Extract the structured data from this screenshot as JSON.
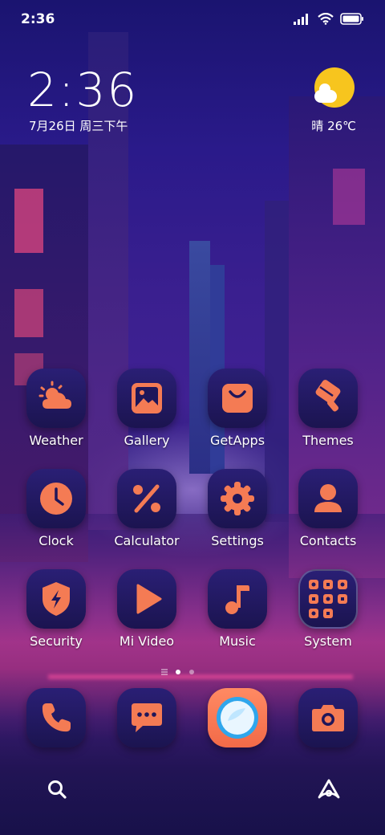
{
  "status_bar": {
    "time": "2:36",
    "icons": [
      "signal-icon",
      "wifi-icon",
      "battery-icon"
    ]
  },
  "clock_widget": {
    "time": "2:36",
    "date": "7月26日 周三下午"
  },
  "weather_widget": {
    "text": "晴 26℃",
    "icon": "sun-cloud-icon"
  },
  "apps": [
    {
      "label": "Weather",
      "icon": "weather-icon"
    },
    {
      "label": "Gallery",
      "icon": "gallery-icon"
    },
    {
      "label": "GetApps",
      "icon": "getapps-icon"
    },
    {
      "label": "Themes",
      "icon": "themes-icon"
    },
    {
      "label": "Clock",
      "icon": "clock-icon"
    },
    {
      "label": "Calculator",
      "icon": "calculator-icon"
    },
    {
      "label": "Settings",
      "icon": "settings-icon"
    },
    {
      "label": "Contacts",
      "icon": "contacts-icon"
    },
    {
      "label": "Security",
      "icon": "security-icon"
    },
    {
      "label": "Mi Video",
      "icon": "play-icon"
    },
    {
      "label": "Music",
      "icon": "music-icon"
    },
    {
      "label": "System",
      "icon": "folder-icon"
    }
  ],
  "page_indicator": {
    "pages": 2,
    "current": 1
  },
  "dock": [
    "phone-icon",
    "messages-icon",
    "browser-icon",
    "camera-icon"
  ],
  "bottom_bar": [
    "search-icon",
    "assistant-icon"
  ],
  "colors": {
    "accent": "#f47b54",
    "sun": "#f7c51e",
    "icon_bg": "#1f165a"
  }
}
